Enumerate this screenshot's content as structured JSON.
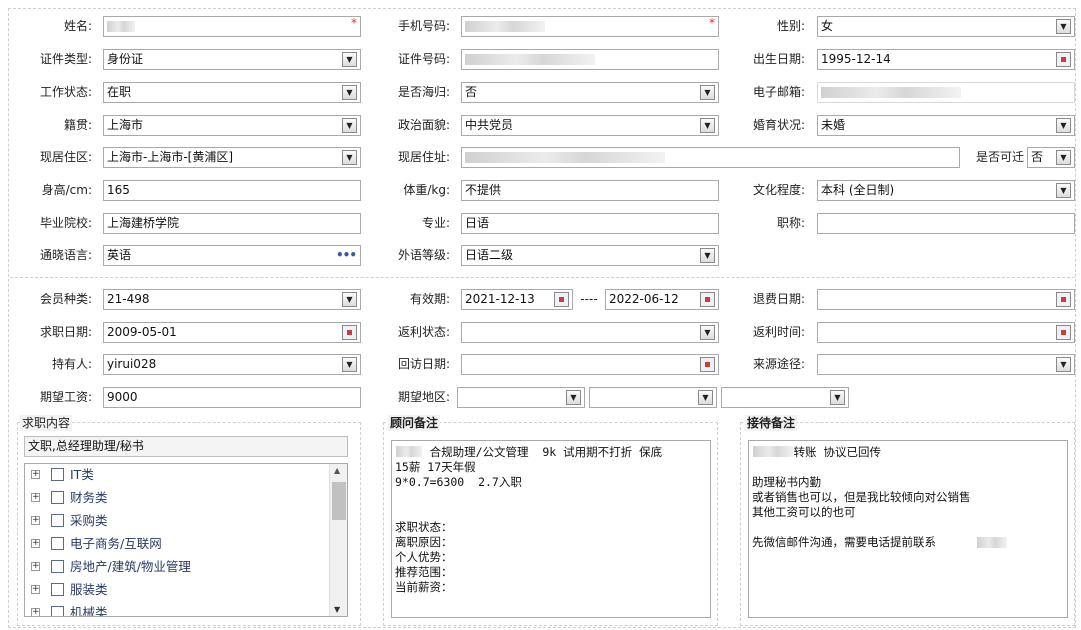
{
  "form": {
    "name": {
      "label": "姓名:",
      "required": "*"
    },
    "mobile": {
      "label": "手机号码:",
      "required": "*"
    },
    "gender": {
      "label": "性别:",
      "value": "女"
    },
    "id_type": {
      "label": "证件类型:",
      "value": "身份证"
    },
    "id_number": {
      "label": "证件号码:"
    },
    "birth_date": {
      "label": "出生日期:",
      "value": "1995-12-14"
    },
    "work_status": {
      "label": "工作状态:",
      "value": "在职"
    },
    "returnee": {
      "label": "是否海归:",
      "value": "否"
    },
    "email": {
      "label": "电子邮箱:"
    },
    "native_place": {
      "label": "籍贯:",
      "value": "上海市"
    },
    "political": {
      "label": "政治面貌:",
      "value": "中共党员"
    },
    "marital": {
      "label": "婚育状况:",
      "value": "未婚"
    },
    "residence_area": {
      "label": "现居住区:",
      "value": "上海市-上海市-[黄浦区]"
    },
    "address": {
      "label": "现居住址:"
    },
    "relocate": {
      "label": "是否可迁",
      "value": "否"
    },
    "height": {
      "label": "身高/cm:",
      "value": "165"
    },
    "weight": {
      "label": "体重/kg:",
      "value": "不提供"
    },
    "education": {
      "label": "文化程度:",
      "value": "本科 (全日制)"
    },
    "school": {
      "label": "毕业院校:",
      "value": "上海建桥学院"
    },
    "major": {
      "label": "专业:",
      "value": "日语"
    },
    "title": {
      "label": "职称:",
      "value": ""
    },
    "language": {
      "label": "通晓语言:",
      "value": "英语",
      "more": "•••"
    },
    "lang_level": {
      "label": "外语等级:",
      "value": "日语二级"
    }
  },
  "member": {
    "type": {
      "label": "会员种类:",
      "value": "21-498"
    },
    "validity": {
      "label": "有效期:",
      "from": "2021-12-13",
      "sep": "----",
      "to": "2022-06-12"
    },
    "refund_date": {
      "label": "退费日期:",
      "value": ""
    },
    "job_date": {
      "label": "求职日期:",
      "value": "2009-05-01"
    },
    "rebate_status": {
      "label": "返利状态:",
      "value": ""
    },
    "rebate_time": {
      "label": "返利时间:",
      "value": ""
    },
    "holder": {
      "label": "持有人:",
      "value": "yirui028"
    },
    "visit_date": {
      "label": "回访日期:",
      "value": ""
    },
    "source": {
      "label": "来源途径:",
      "value": ""
    },
    "salary": {
      "label": "期望工资:",
      "value": "9000"
    },
    "region": {
      "label": "期望地区:"
    }
  },
  "job_panel": {
    "title": "求职内容",
    "selected": "文职,总经理助理/秘书",
    "tree": [
      "IT类",
      "财务类",
      "采购类",
      "电子商务/互联网",
      "房地产/建筑/物业管理",
      "服装类",
      "机械类"
    ],
    "expander": "+",
    "scroll_up": "▲",
    "scroll_down": "▼"
  },
  "consultant_panel": {
    "title": "顾问备注",
    "text": "     合规助理/公文管理  9k 试用期不打折 保底\n15薪 17天年假\n9*0.7=6300  2.7入职\n\n\n求职状态：\n离职原因：\n个人优势：\n推荐范围：\n当前薪资："
  },
  "reception_panel": {
    "title": "接待备注",
    "text": "      转账 协议已回传\n\n助理秘书内勤\n或者销售也可以，但是我比较倾向对公销售\n其他工资可以的也可\n\n先微信邮件沟通，需要电话提前联系"
  },
  "icons": {
    "dropdown": "▼"
  }
}
